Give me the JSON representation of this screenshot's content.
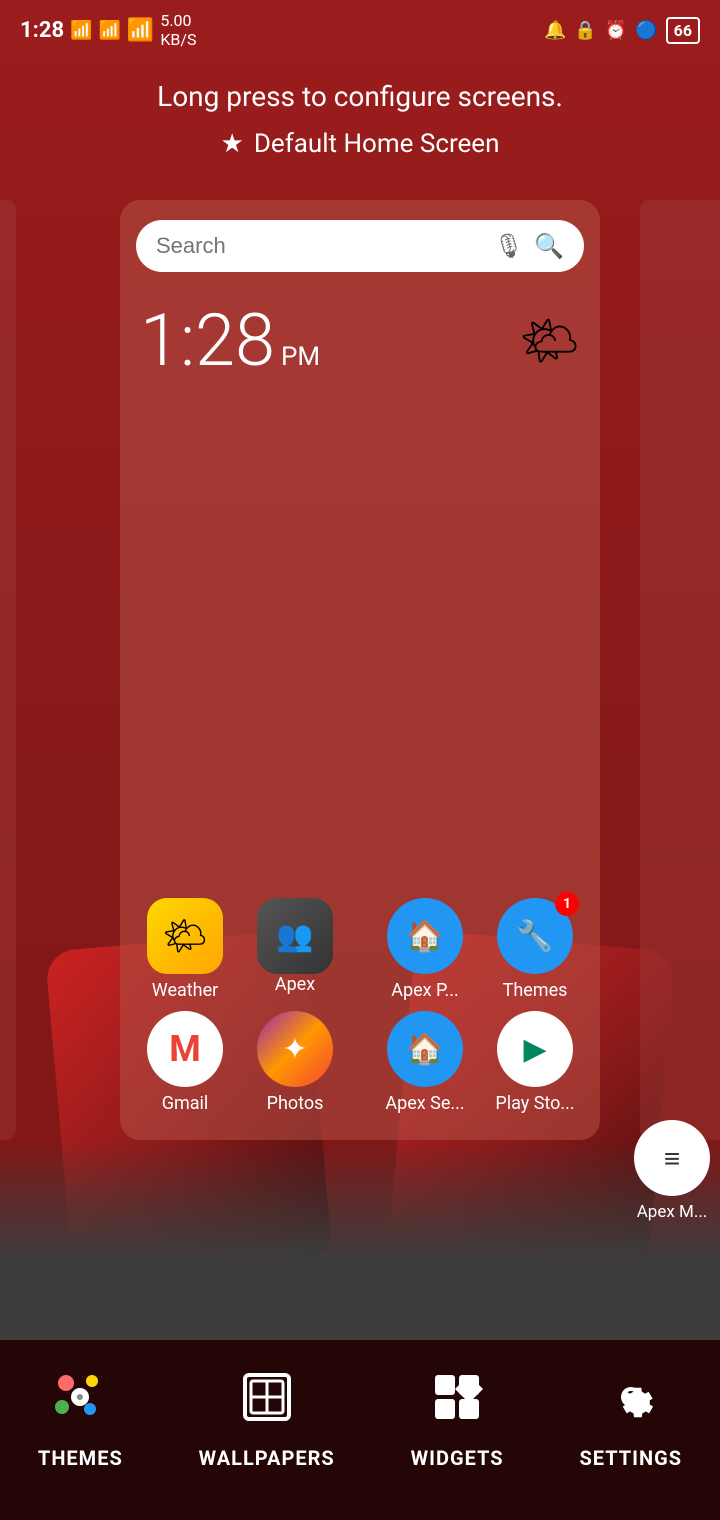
{
  "statusBar": {
    "time": "1:28",
    "network": "5.00\nKB/S",
    "battery": "66",
    "icons": [
      "signal",
      "signal2",
      "wifi",
      "vibrate",
      "lock",
      "alarm",
      "bluetooth"
    ]
  },
  "topMessage": {
    "configureText": "Long press to configure screens.",
    "defaultHomeText": "Default Home Screen",
    "starIcon": "★"
  },
  "clock": {
    "time": "1:28",
    "ampm": "PM"
  },
  "search": {
    "placeholder": "Search"
  },
  "apps": {
    "row1": [
      {
        "id": "weather",
        "label": "Weather",
        "icon": "🌤",
        "iconClass": "icon-weather",
        "badge": null
      },
      {
        "id": "apex",
        "label": "Apex",
        "icon": "👤",
        "iconClass": "icon-apex",
        "badge": null
      },
      {
        "id": "apex-p",
        "label": "Apex P...",
        "icon": "🏠",
        "iconClass": "icon-apex-p",
        "badge": null
      },
      {
        "id": "themes",
        "label": "Themes",
        "icon": "🔧",
        "iconClass": "icon-themes",
        "badge": "1"
      }
    ],
    "row2": [
      {
        "id": "gmail",
        "label": "Gmail",
        "icon": "M",
        "iconClass": "icon-gmail",
        "badge": null
      },
      {
        "id": "photos",
        "label": "Photos",
        "icon": "✦",
        "iconClass": "icon-photos",
        "badge": null
      },
      {
        "id": "apex-se",
        "label": "Apex Se...",
        "icon": "🏠",
        "iconClass": "icon-apex-se",
        "badge": null
      },
      {
        "id": "playstore",
        "label": "Play Sto...",
        "icon": "▶",
        "iconClass": "icon-playstore",
        "badge": null
      },
      {
        "id": "apex-m",
        "label": "Apex M...",
        "icon": "≡",
        "iconClass": "icon-apex-m",
        "badge": null
      }
    ]
  },
  "bottomNav": {
    "items": [
      {
        "id": "themes",
        "label": "THEMES",
        "icon": "palette"
      },
      {
        "id": "wallpapers",
        "label": "WALLPAPERS",
        "icon": "wallpaper"
      },
      {
        "id": "widgets",
        "label": "WIDGETS",
        "icon": "widgets"
      },
      {
        "id": "settings",
        "label": "SETTINGS",
        "icon": "settings"
      }
    ]
  }
}
